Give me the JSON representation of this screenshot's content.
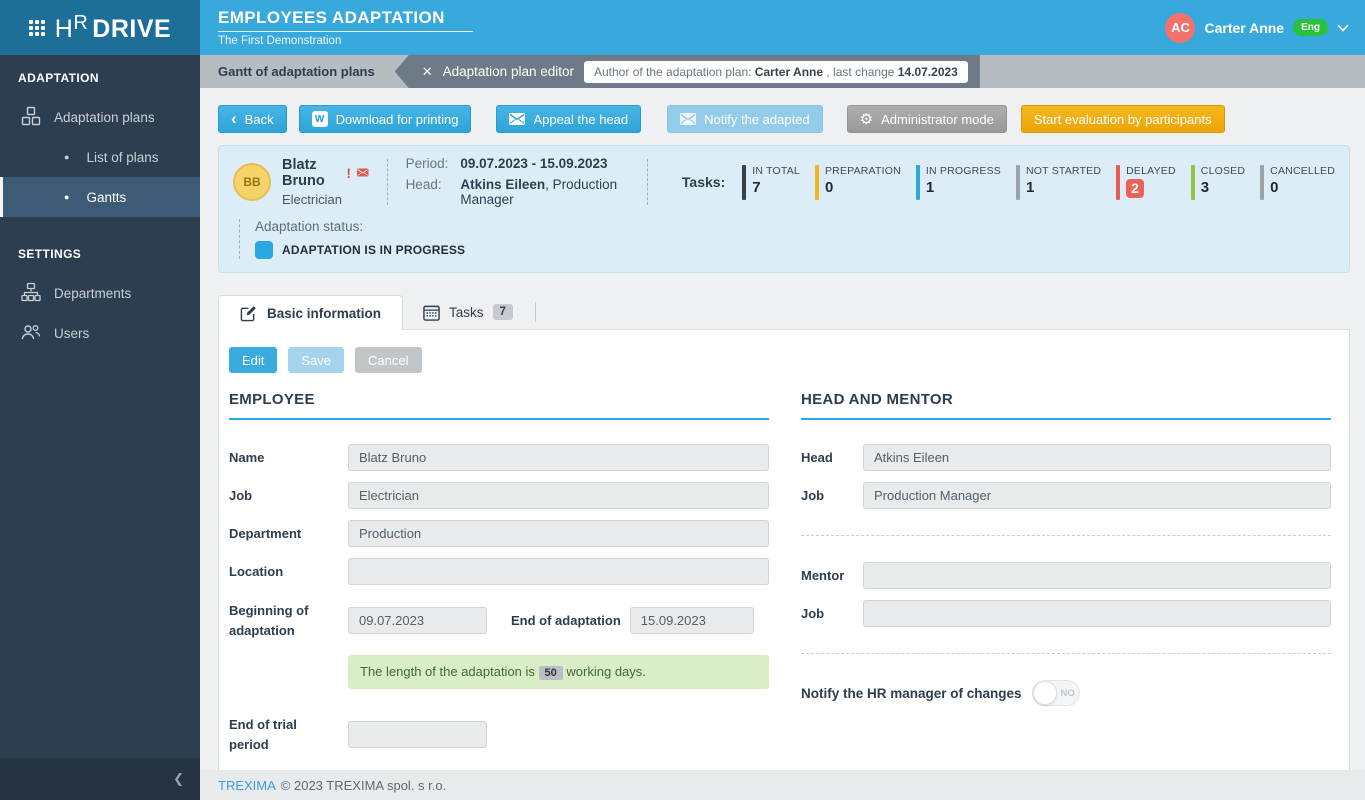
{
  "icons": {
    "back_chevron": "‹",
    "close": "✕",
    "collapse_chevron": "❮",
    "gear": "⚙",
    "word_doc_letter": "W",
    "bullet": "●"
  },
  "header": {
    "logo_h": "H",
    "logo_r": "R",
    "logo_drive": "DRIVE",
    "title": "EMPLOYEES ADAPTATION",
    "subtitle": "The First Demonstration",
    "user_initials": "AC",
    "user_name": "Carter Anne",
    "user_lang": "Eng",
    "header_color": "#38a9dc",
    "logo_bg_color": "#1d6f9a",
    "avatar_color": "#f2726b",
    "lang_badge_color": "#29c23a"
  },
  "window_tabs": {
    "gantt_tab": "Gantt of adaptation plans",
    "editor_tab": "Adaptation plan editor",
    "author_label": "Author of the adaptation plan:",
    "author_name": "Carter Anne",
    "last_change_label": ", last change",
    "last_change_date": "14.07.2023"
  },
  "sidebar": {
    "section_adaptation": "ADAPTATION",
    "adaptation_plans": "Adaptation plans",
    "list_of_plans": "List of plans",
    "gantts": "Gantts",
    "section_settings": "SETTINGS",
    "departments": "Departments",
    "users": "Users",
    "bg_color": "#2d3e50",
    "active_item_color": "#3d5a76"
  },
  "toolbar": {
    "back": "Back",
    "download": "Download for printing",
    "appeal": "Appeal the head",
    "notify": "Notify the adapted",
    "admin_mode": "Administrator mode",
    "start_evaluation": "Start evaluation by participants",
    "primary_color": "#39abdf",
    "disabled_color": "#93cce9",
    "gray_color": "#a2a2a2",
    "warning_color": "#f0ab10"
  },
  "summary": {
    "avatar_initials": "BB",
    "employee_name": "Blatz Bruno",
    "alert_mark": "!",
    "employee_job": "Electrician",
    "period_label": "Period:",
    "period_value": "09.07.2023 - 15.09.2023",
    "head_label": "Head:",
    "head_name": "Atkins Eileen",
    "head_job_suffix": ", Production Manager",
    "tasks_label": "Tasks:",
    "counters": [
      {
        "label": "IN TOTAL",
        "value": "7",
        "color": "#3b4248",
        "badge": false
      },
      {
        "label": "PREPARATION",
        "value": "0",
        "color": "#f2b31b",
        "badge": false
      },
      {
        "label": "IN PROGRESS",
        "value": "1",
        "color": "#2aa9e0",
        "badge": false
      },
      {
        "label": "NOT STARTED",
        "value": "1",
        "color": "#9ba3ab",
        "badge": false
      },
      {
        "label": "DELAYED",
        "value": "2",
        "color": "#e95d55",
        "badge": true
      },
      {
        "label": "CLOSED",
        "value": "3",
        "color": "#8dc63f",
        "badge": false
      },
      {
        "label": "CANCELLED",
        "value": "0",
        "color": "#9ba3ab",
        "badge": false
      }
    ],
    "status_label": "Adaptation status:",
    "status_value": "ADAPTATION IS IN PROGRESS",
    "status_color": "#29a9e0"
  },
  "content_tabs": {
    "basic_information": "Basic information",
    "tasks": "Tasks",
    "tasks_badge": "7"
  },
  "form": {
    "edit": "Edit",
    "save": "Save",
    "cancel": "Cancel",
    "employee_section": "EMPLOYEE",
    "name_label": "Name",
    "name_value": "Blatz Bruno",
    "job_label": "Job",
    "job_value": "Electrician",
    "department_label": "Department",
    "department_value": "Production",
    "location_label": "Location",
    "location_value": "",
    "begin_label": "Beginning of adaptation",
    "begin_value": "09.07.2023",
    "end_label": "End of adaptation",
    "end_value": "15.09.2023",
    "length_text_1": "The length of the adaptation is",
    "length_days": "50",
    "length_text_2": "working days.",
    "trial_label": "End of trial period",
    "trial_value": "",
    "head_section": "HEAD AND MENTOR",
    "head_label": "Head",
    "head_value": "Atkins Eileen",
    "head_job_label": "Job",
    "head_job_value": "Production Manager",
    "mentor_label": "Mentor",
    "mentor_value": "",
    "mentor_job_label": "Job",
    "mentor_job_value": "",
    "notify_label": "Notify the HR manager of changes",
    "toggle_state": "NO"
  },
  "footer": {
    "link": "TREXIMA",
    "text": "© 2023 TREXIMA spol. s r.o."
  }
}
